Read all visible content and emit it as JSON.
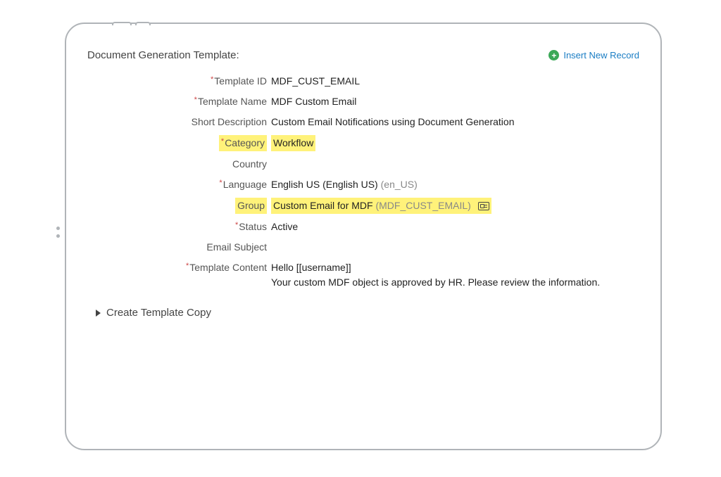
{
  "header": {
    "title": "Document Generation Template:",
    "insert_label": "Insert New Record"
  },
  "fields": {
    "template_id": {
      "label": "Template ID",
      "value": "MDF_CUST_EMAIL"
    },
    "template_name": {
      "label": "Template Name",
      "value": "MDF Custom Email"
    },
    "short_description": {
      "label": "Short Description",
      "value": "Custom Email Notifications using Document Generation"
    },
    "category": {
      "label": "Category",
      "value": "Workflow"
    },
    "country": {
      "label": "Country",
      "value": ""
    },
    "language": {
      "label": "Language",
      "value": "English US (English US)",
      "hint": "(en_US)"
    },
    "group": {
      "label": "Group",
      "value": "Custom Email for MDF",
      "hint": "(MDF_CUST_EMAIL)"
    },
    "status": {
      "label": "Status",
      "value": "Active"
    },
    "email_subject": {
      "label": "Email Subject",
      "value": ""
    },
    "template_content": {
      "label": "Template Content",
      "value": "Hello [[username]]\nYour custom MDF object is approved by HR. Please review the information."
    }
  },
  "expander": {
    "label": "Create Template Copy"
  }
}
